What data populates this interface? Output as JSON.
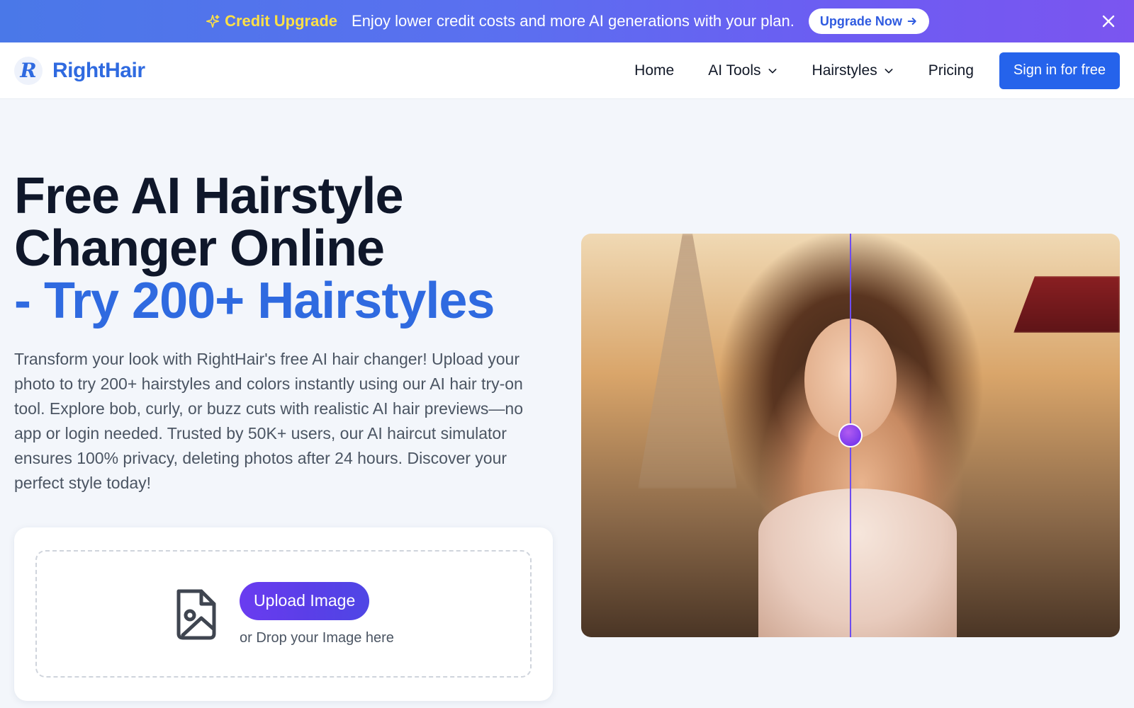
{
  "banner": {
    "title": "Credit Upgrade",
    "title_icon": "sparkle-icon",
    "message": "Enjoy lower credit costs and more AI generations with your plan.",
    "button_label": "Upgrade Now",
    "button_icon": "arrow-right-icon",
    "close_icon": "close-icon"
  },
  "header": {
    "logo_letter": "R",
    "brand_name": "RightHair",
    "nav": [
      {
        "label": "Home",
        "dropdown": false
      },
      {
        "label": "AI Tools",
        "dropdown": true
      },
      {
        "label": "Hairstyles",
        "dropdown": true
      },
      {
        "label": "Pricing",
        "dropdown": false
      }
    ],
    "signin_label": "Sign in for free"
  },
  "hero": {
    "title_line1": "Free AI Hairstyle",
    "title_line2": "Changer Online",
    "title_accent": "- Try 200+ Hairstyles",
    "description": "Transform your look with RightHair's free AI hair changer! Upload your photo to try 200+ hairstyles and colors instantly using our AI hair try-on tool. Explore bob, curly, or buzz cuts with realistic AI hair previews—no app or login needed. Trusted by 50K+ users, our AI haircut simulator ensures 100% privacy, deleting photos after 24 hours. Discover your perfect style today!"
  },
  "upload": {
    "button_label": "Upload Image",
    "drop_text": "or Drop your Image here",
    "icon": "image-file-icon"
  },
  "comparison": {
    "slider_position": 0.5,
    "colors": {
      "divider": "#6d4cf0",
      "handle": "#7c3aed"
    }
  },
  "colors": {
    "brand": "#2f6ae0",
    "banner_highlight": "#fde047",
    "signin_bg": "#2563eb"
  }
}
